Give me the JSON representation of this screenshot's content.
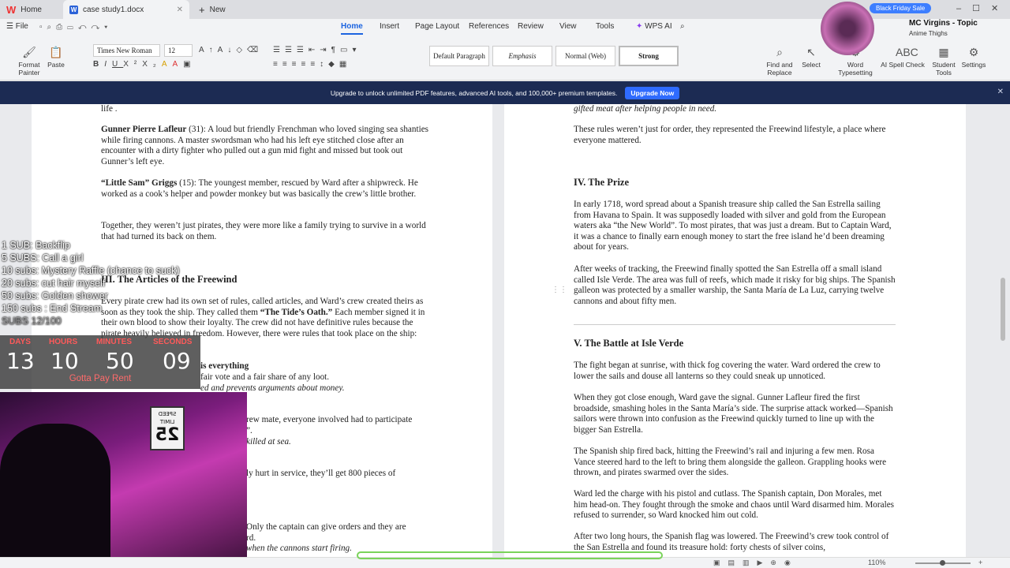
{
  "tabs": {
    "home": "Home",
    "document": "case study1.docx",
    "new": "New"
  },
  "menu": {
    "file": "File",
    "items": [
      "Home",
      "Insert",
      "Page Layout",
      "References",
      "Review",
      "View",
      "Tools"
    ],
    "wps_ai": "WPS AI"
  },
  "ribbon": {
    "format_painter": "Format Painter",
    "paste": "Paste",
    "font": "Times New Roman",
    "size": "12",
    "styles": [
      "Default Paragraph",
      "Emphasis",
      "Normal (Web)",
      "Strong"
    ],
    "find_replace": "Find and Replace",
    "select": "Select",
    "word_typesetting": "Word Typesetting",
    "ai_spell": "AI Spell Check",
    "student_tools": "Student Tools",
    "settings": "Settings"
  },
  "banner": {
    "text": "Upgrade to unlock unlimited PDF features, advanced AI tools, and 100,000+ premium templates.",
    "button": "Upgrade Now"
  },
  "streamer": {
    "badge": "Black Friday Sale",
    "title": "MC Virgins - Topic",
    "subtitle": "Anime Thighs"
  },
  "left_page": {
    "p0": "life .",
    "p1_bold": "Gunner Pierre Lafleur",
    "p1": " (31): A loud but friendly Frenchman who loved singing sea shanties while firing cannons. A master swordsman who had his left eye stitched close after an encounter with a dirty fighter who pulled out a gun mid fight and missed but took out Gunner’s left eye.",
    "p2_bold": "“Little Sam” Griggs",
    "p2": " (15): The youngest member, rescued by Ward after a shipwreck. He worked as a cook’s helper and powder monkey but was basically the crew’s little brother.",
    "p3": "Together, they weren’t just pirates, they were more like a family trying to survive in a world that had turned its back on them.",
    "h3": "III. The Articles of the Freewind",
    "p4a": "Every pirate crew had its own set of rules, called articles, and Ward’s crew created theirs as soon as they took the ship. They called them ",
    "p4b": "“The Tide’s Oath.”",
    "p4c": " Each member signed it in their own blood to show their loyalty. The crew did not have definitive rules because the pirate heavily believed in freedom. However, there were rules that took place on the ship:",
    "l1": "is everything",
    "l2": "fair vote and a fair share of any loot.",
    "l3": "ed and prevents arguments about money.",
    "l4": "rew mate, everyone involved had to participate",
    "l5": "”.",
    "l6": "killed at sea.",
    "l7": "ly hurt in service, they’ll get 800 pieces of",
    "l8": "Only the captain can give orders and they are",
    "l9": "rd.",
    "l10": "when the cannons start firing."
  },
  "right_page": {
    "p0": "gifted meat after helping people in need.",
    "p1": "These rules weren’t just for order, they represented the Freewind lifestyle, a place where everyone mattered.",
    "h4": "IV. The Prize",
    "p2": "In early 1718, word spread about a Spanish treasure ship called the San Estrella sailing from Havana to Spain. It was supposedly loaded with silver and gold from the European waters aka “the New World”. To most pirates, that was just a dream. But to Captain Ward, it was a chance to finally earn enough money to start the free island he’d been dreaming about for years.",
    "p3": "After weeks of tracking, the Freewind finally spotted the San Estrella off a small island called Isle Verde. The area was full of reefs, which made it risky for big ships. The Spanish galleon was protected by a smaller warship, the Santa María de La Luz, carrying twelve cannons and about fifty men.",
    "h5": "V. The Battle at Isle Verde",
    "p4": "The fight began at sunrise, with thick fog covering the water. Ward ordered the crew to lower the sails and douse all lanterns so they could sneak up unnoticed.",
    "p5": "When they got close enough, Ward gave the signal. Gunner Lafleur fired the first broadside, smashing holes in the Santa María’s side. The surprise attack worked—Spanish sailors were thrown into confusion as the Freewind quickly turned to line up with the bigger San Estrella.",
    "p6": "The Spanish ship fired back, hitting the Freewind’s rail and injuring a few men. Rosa Vance steered hard to the left to bring them alongside the galleon. Grappling hooks were thrown, and pirates swarmed over the sides.",
    "p7": "Ward led the charge with his pistol and cutlass. The Spanish captain, Don Morales, met him head-on. They fought through the smoke and chaos until Ward disarmed him. Morales refused to surrender, so Ward knocked him out cold.",
    "p8": "After two long hours, the Spanish flag was lowered. The Freewind’s crew took control of the San Estrella and found its treasure hold: forty chests of silver coins,"
  },
  "subs_goals": [
    "1 SUB: Backflip",
    "5 SUBS: Call a girl",
    "10 subs: Mystery Raffle (chance to suck)",
    "20 subs: cut hair myself",
    "50 subs: Golden shower",
    "150 subs : End Stream"
  ],
  "subs_count": "SUBS 12/100",
  "timer": {
    "labels": [
      "DAYS",
      "HOURS",
      "MINUTES",
      "SECONDS"
    ],
    "values": [
      "13",
      "10",
      "50",
      "09"
    ],
    "caption": "Gotta Pay Rent"
  },
  "sign": {
    "line1": "SPEED",
    "line2": "LIMIT",
    "line3": "25"
  },
  "status": {
    "zoom": "110%"
  }
}
